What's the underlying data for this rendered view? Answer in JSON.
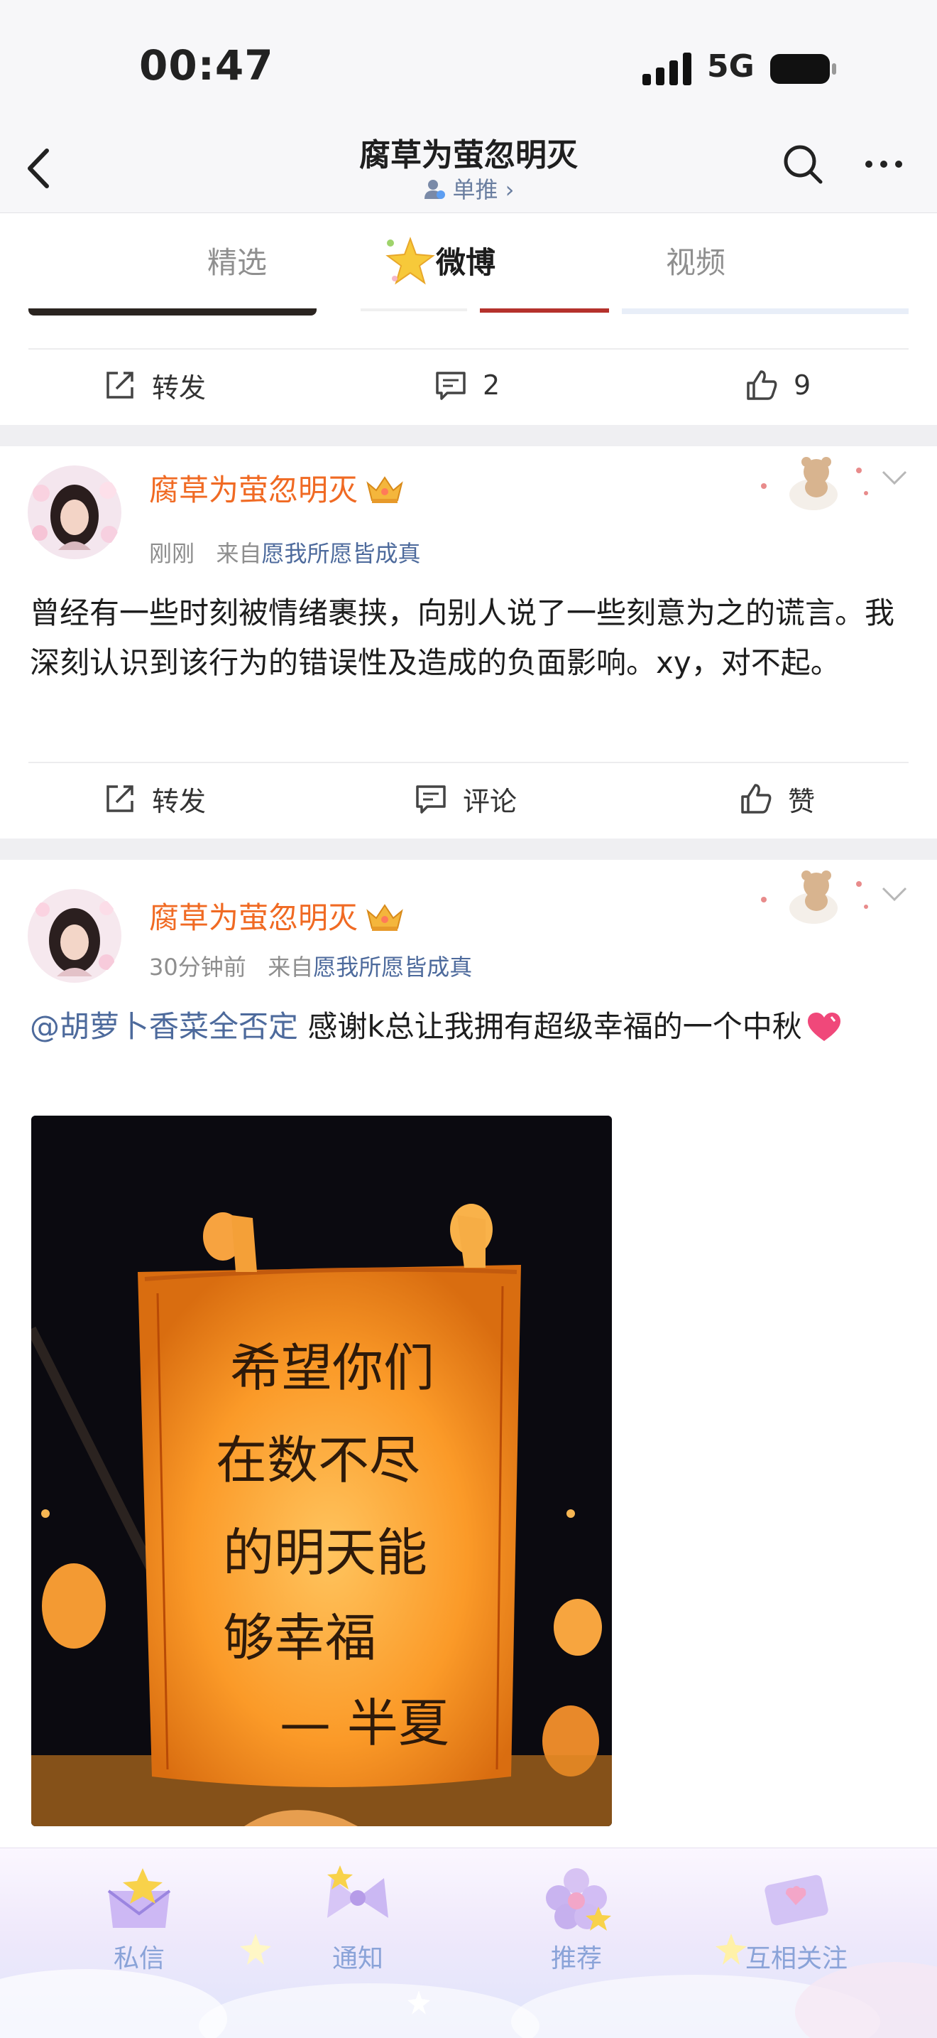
{
  "status_bar": {
    "time": "00:47",
    "network": "5G"
  },
  "header": {
    "title": "腐草为萤忽明灭",
    "subtitle": "单推 ›"
  },
  "tabs": [
    {
      "label": "精选",
      "active": false
    },
    {
      "label": "微博",
      "active": true
    },
    {
      "label": "视频",
      "active": false
    }
  ],
  "previous_post": {
    "actions": {
      "repost": "转发",
      "comments": "2",
      "likes": "9"
    }
  },
  "posts": [
    {
      "author": "腐草为萤忽明灭",
      "time": "刚刚",
      "source_prefix": "来自",
      "source": "愿我所愿皆成真",
      "text": "曾经有一些时刻被情绪裹挟，向别人说了一些刻意为之的谎言。我深刻认识到该行为的错误性及造成的负面影响。xy，对不起。",
      "actions": {
        "repost": "转发",
        "comment": "评论",
        "like": "赞"
      }
    },
    {
      "author": "腐草为萤忽明灭",
      "time": "30分钟前",
      "source_prefix": "来自",
      "source": "愿我所愿皆成真",
      "mention": "@胡萝卜香菜全否定",
      "text": " 感谢k总让我拥有超级幸福的一个中秋",
      "photo_text": [
        "希望你们",
        "在数不尽",
        "的明天能",
        "够幸福",
        "— 半夏"
      ]
    }
  ],
  "bottom_nav": [
    {
      "label": "私信"
    },
    {
      "label": "通知"
    },
    {
      "label": "推荐"
    },
    {
      "label": "互相关注"
    }
  ],
  "colors": {
    "username": "#f06a23",
    "link": "#4d6a9c",
    "nav_label": "#8aa3d8"
  }
}
